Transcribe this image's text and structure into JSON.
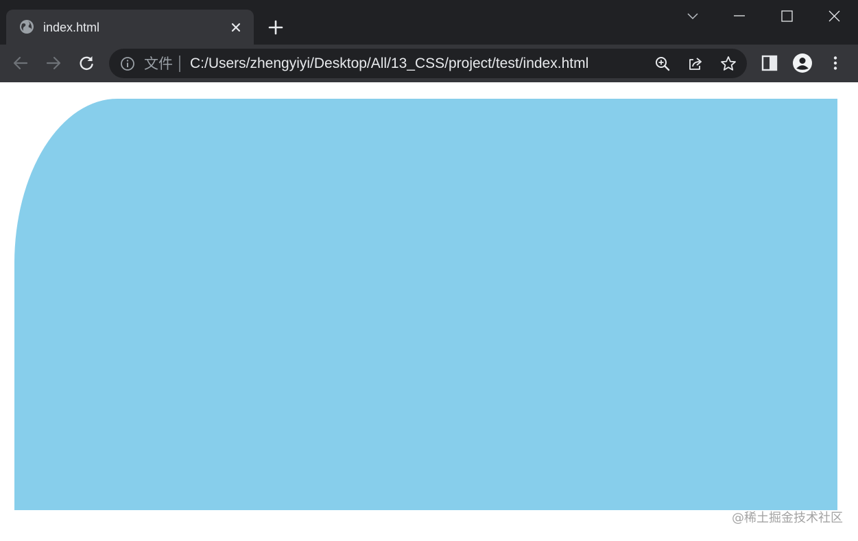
{
  "browser": {
    "tab": {
      "title": "index.html",
      "favicon": "globe-icon"
    },
    "address_bar": {
      "security_label": "文件",
      "url": "C:/Users/zhengyiyi/Desktop/All/13_CSS/project/test/index.html"
    },
    "icons": {
      "back": "arrow-left-icon",
      "forward": "arrow-right-icon",
      "reload": "reload-icon",
      "info": "info-icon",
      "zoom": "zoom-in-icon",
      "share": "share-icon",
      "bookmark": "star-icon",
      "side_panel": "side-panel-icon",
      "profile": "profile-icon",
      "menu": "kebab-menu-icon",
      "new_tab": "plus-icon",
      "close_tab": "close-icon",
      "tab_search": "chevron-down-icon",
      "minimize": "minimize-icon",
      "maximize": "maximize-icon",
      "close_window": "close-icon"
    },
    "colors": {
      "tabstrip_bg": "#202124",
      "toolbar_bg": "#35363a",
      "omnibox_bg": "#202124"
    }
  },
  "page": {
    "box_color": "#87ceeb",
    "watermark": "@稀土掘金技术社区"
  }
}
